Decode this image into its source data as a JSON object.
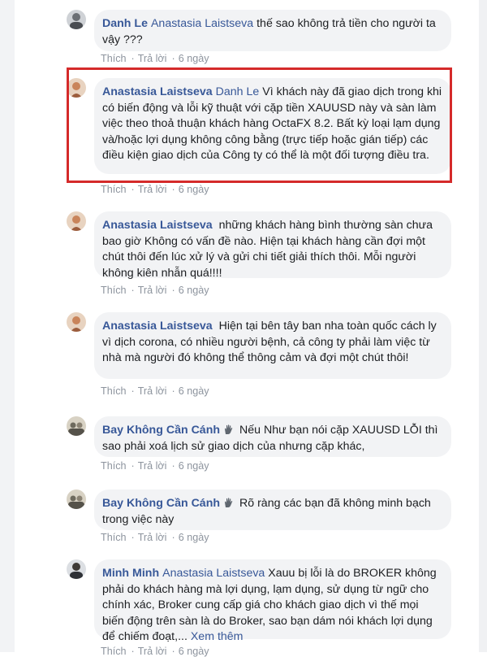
{
  "comments": [
    {
      "author": "Danh Le",
      "mention": "Anastasia Laistseva",
      "text": "thế sao không trả tiền cho người ta vậy ???",
      "like_label": "Thích",
      "reply_label": "Trả lời",
      "time": "6 ngày"
    },
    {
      "author": "Anastasia Laistseva",
      "mention": "Danh Le",
      "text": "Vì khách này đã giao dịch trong khi có biến động và lỗi kỹ thuật với cặp tiền XAUUSD này và sàn làm việc theo thoả thuận khách hàng OctaFX 8.2. Bất kỳ loại lạm dụng và/hoặc lợi dụng không công bằng (trực tiếp hoặc gián tiếp) các điều kiện giao dịch của Công ty có thể là một đối tượng điều tra.",
      "like_label": "Thích",
      "reply_label": "Trả lời",
      "time": "6 ngày"
    },
    {
      "author": "Anastasia Laistseva",
      "mention": "",
      "text": "những khách hàng bình thường sàn chưa bao giờ Không có vấn đề nào. Hiện tại khách hàng cần đợi một chút thôi đến lúc xử lý và gửi chi tiết giải thích thôi. Mỗi người không kiên nhẫn quá!!!!",
      "like_label": "Thích",
      "reply_label": "Trả lời",
      "time": "6 ngày"
    },
    {
      "author": "Anastasia Laistseva",
      "mention": "",
      "text": "Hiện tại bên tây ban nha toàn quốc cách ly vì dịch corona, có nhiều người bệnh, cả công ty phải làm việc từ nhà mà người đó không thể thông cảm và đợi một chút thôi!",
      "like_label": "Thích",
      "reply_label": "Trả lời",
      "time": "6 ngày"
    },
    {
      "author": "Bay Không Cần Cánh",
      "mention": "",
      "text": "Nếu Như bạn nói cặp XAUUSD LỖI thì sao phải xoá lịch sử giao dịch của nhưng cặp khác,",
      "like_label": "Thích",
      "reply_label": "Trả lời",
      "time": "6 ngày"
    },
    {
      "author": "Bay Không Cần Cánh",
      "mention": "",
      "text": "Rõ ràng các bạn đã không minh bạch trong việc này",
      "like_label": "Thích",
      "reply_label": "Trả lời",
      "time": "6 ngày"
    },
    {
      "author": "Minh Minh",
      "mention": "Anastasia Laistseva",
      "text": "Xauu bị lỗi là do BROKER không phải do khách hàng mà lợi dụng, lạm dụng, sử dụng từ ngữ cho chính xác, Broker cung cấp giá cho khách giao dịch vì thế mọi biến động trên sàn là do Broker, sao bạn dám nói khách lợi dụng để chiếm đoạt,...",
      "see_more": "Xem thêm",
      "like_label": "Thích",
      "reply_label": "Trả lời",
      "time": "6 ngày"
    }
  ],
  "colors": {
    "link": "#385898",
    "bubble": "#f2f3f5",
    "meta": "#8d949e",
    "highlight": "#d52a2a"
  }
}
